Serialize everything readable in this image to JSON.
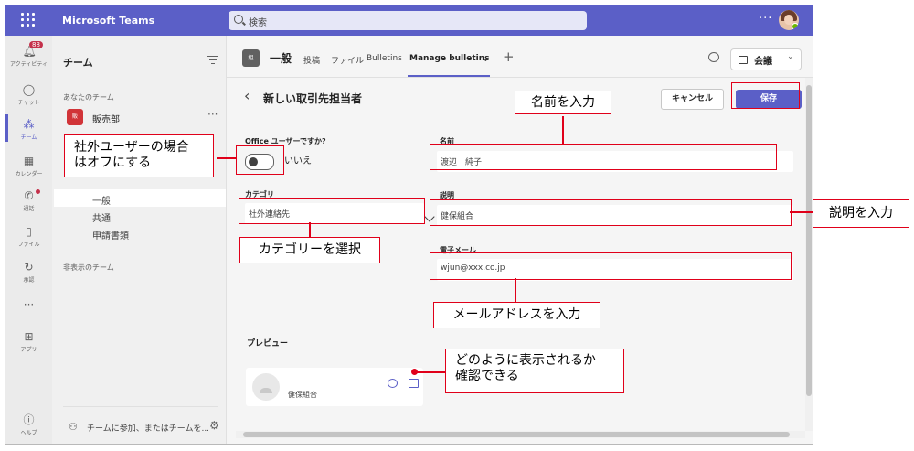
{
  "app": {
    "title": "Microsoft Teams",
    "search_placeholder": "検索",
    "more": "···"
  },
  "rail": [
    {
      "id": "activity",
      "label": "アクティビティ",
      "icon": "bell-icon",
      "badge": "88"
    },
    {
      "id": "chat",
      "label": "チャット",
      "icon": "chat-icon"
    },
    {
      "id": "teams",
      "label": "チーム",
      "icon": "teams-icon"
    },
    {
      "id": "calendar",
      "label": "カレンダー",
      "icon": "calendar-icon"
    },
    {
      "id": "calls",
      "label": "通話",
      "icon": "phone-icon"
    },
    {
      "id": "files",
      "label": "ファイル",
      "icon": "file-icon"
    },
    {
      "id": "approvals",
      "label": "承認",
      "icon": "approvals-icon"
    },
    {
      "id": "more",
      "label": "···",
      "icon": "more-icon"
    },
    {
      "id": "apps",
      "label": "アプリ",
      "icon": "apps-icon"
    },
    {
      "id": "help",
      "label": "ヘルプ",
      "icon": "help-icon"
    }
  ],
  "sidebar": {
    "title": "チーム",
    "section_yours": "あなたのチーム",
    "team_name": "販売部",
    "team_icon_text": "販",
    "channels": [
      "一般",
      "共通",
      "申請書類"
    ],
    "section_hidden": "非表示のチーム",
    "join": "チームに参加、またはチームを..."
  },
  "header": {
    "team_icon_text": "組",
    "title": "一般",
    "tabs": [
      "投稿",
      "ファイル",
      "Bulletins",
      "Manage bulletins"
    ],
    "meet_label": "会議"
  },
  "form": {
    "title": "新しい取引先担当者",
    "cancel": "キャンセル",
    "save": "保存",
    "office_user_label": "Office ユーザーですか?",
    "office_user_value": "いいえ",
    "category_label": "カテゴリ",
    "category_value": "社外連絡先",
    "name_label": "名前",
    "name_value": "渡辺　純子",
    "desc_label": "説明",
    "desc_value": "健保組合",
    "email_label": "電子メール",
    "email_value": "wjun@xxx.co.jp",
    "preview_label": "プレビュー",
    "preview_text": "健保組合"
  },
  "annotations": {
    "name": "名前を入力",
    "external": "社外ユーザーの場合\nはオフにする",
    "category": "カテゴリーを選択",
    "desc": "説明を入力",
    "email": "メールアドレスを入力",
    "preview": "どのように表示されるか\n確認できる"
  },
  "colors": {
    "brand": "#5b5fc7",
    "annotation": "#e0001a",
    "badge": "#c4314b"
  }
}
